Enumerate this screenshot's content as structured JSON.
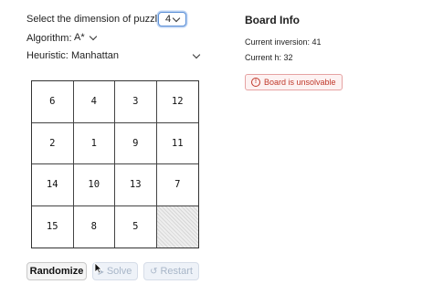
{
  "dimension": {
    "label": "Select the dimension of puzzle:",
    "value": "4"
  },
  "algorithm": {
    "label": "Algorithm:",
    "value": "A*"
  },
  "heuristic": {
    "label": "Heuristic:",
    "value": "Manhattan"
  },
  "board": {
    "tiles": [
      "6",
      "4",
      "3",
      "12",
      "2",
      "1",
      "9",
      "11",
      "14",
      "10",
      "13",
      "7",
      "15",
      "8",
      "5",
      ""
    ]
  },
  "buttons": {
    "randomize": "Randomize",
    "solve": "Solve",
    "restart": "Restart"
  },
  "info": {
    "title": "Board Info",
    "inversion": "Current inversion: 41",
    "h": "Current h: 32",
    "alert": "Board is unsolvable"
  }
}
